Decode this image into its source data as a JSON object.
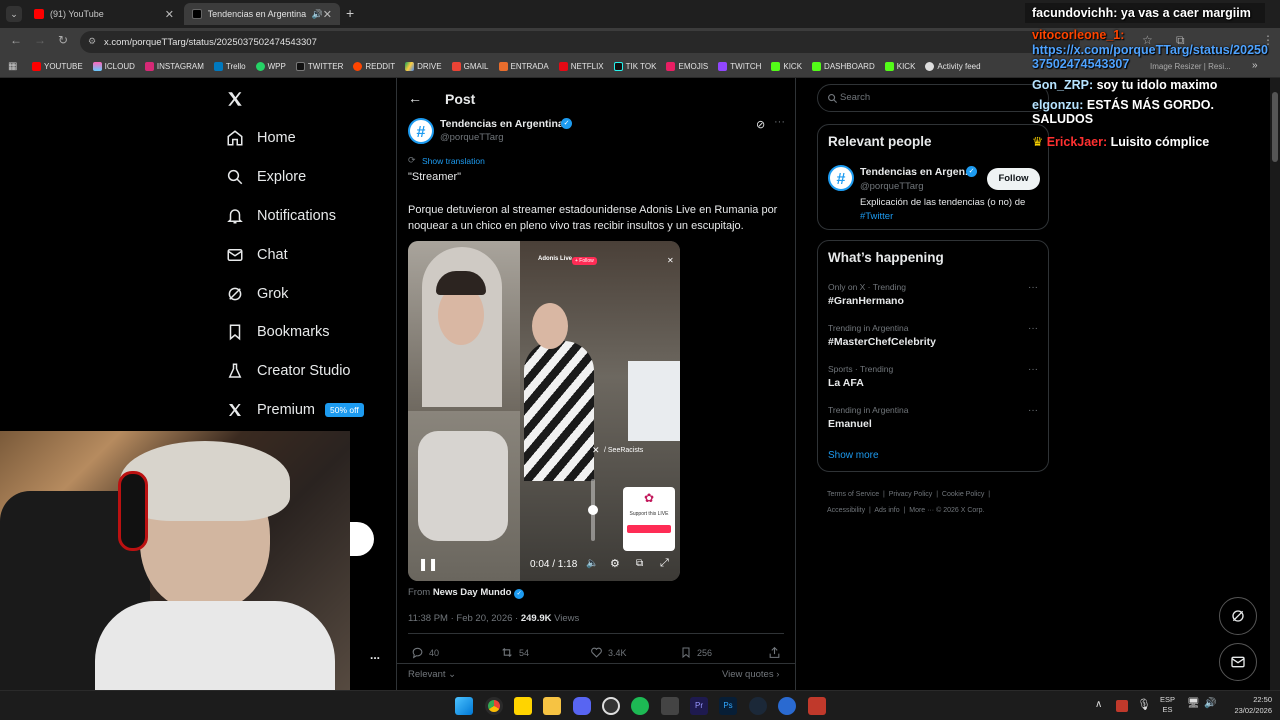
{
  "browser": {
    "tabs": [
      {
        "title": "(91) YouTube",
        "active": false
      },
      {
        "title": "Tendencias en Argentina on",
        "active": true
      }
    ],
    "url": "x.com/porqueTTarg/status/2025037502474543307",
    "bookmarks": [
      "YOUTUBE",
      "ICLOUD",
      "INSTAGRAM",
      "Trello",
      "WPP",
      "TWITTER",
      "REDDIT",
      "DRIVE",
      "GMAIL",
      "ENTRADA",
      "NETFLIX",
      "TIK TOK",
      "EMOJIS",
      "TWITCH",
      "KICK",
      "DASHBOARD",
      "KICK",
      "Activity feed"
    ],
    "bookmark_overflow": "Image Resizer | Resi..."
  },
  "sidebar": {
    "items": [
      {
        "label": "Home",
        "icon": "home-icon"
      },
      {
        "label": "Explore",
        "icon": "search-icon"
      },
      {
        "label": "Notifications",
        "icon": "bell-icon"
      },
      {
        "label": "Chat",
        "icon": "mail-icon"
      },
      {
        "label": "Grok",
        "icon": "grok-icon"
      },
      {
        "label": "Bookmarks",
        "icon": "bookmark-icon"
      },
      {
        "label": "Creator Studio",
        "icon": "flask-icon"
      },
      {
        "label": "Premium",
        "icon": "x-logo-icon"
      }
    ],
    "premium_badge": "50% off",
    "more_dots": "..."
  },
  "post": {
    "header": "Post",
    "author_name": "Tendencias en Argentina",
    "author_handle": "@porqueTTarg",
    "show_translation": "Show translation",
    "title_line": "\"Streamer\"",
    "body": "Porque detuvieron al streamer estadounidense Adonis Live en Rumania por noquear a un chico en pleno vivo tras recibir insultos y un escupitajo.",
    "video_time": "0:04 / 1:18",
    "video_overlay_tag": "/ SeeRacists",
    "video_support": "Support this LIVE",
    "video_streamer": "Adonis Live",
    "video_follow": "+ Follow",
    "from_label": "From",
    "from_source": "News Day Mundo",
    "timestamp": "11:38 PM · Feb 20, 2026 · ",
    "views_count": "249.9K",
    "views_label": " Views",
    "replies": "40",
    "reposts": "54",
    "likes": "3.4K",
    "bookmarks": "256",
    "relevant_label": "Relevant",
    "view_quotes": "View quotes"
  },
  "right": {
    "search_placeholder": "Search",
    "relevant_people_title": "Relevant people",
    "person_name": "Tendencias en Argen...",
    "person_handle": "@porqueTTarg",
    "follow_label": "Follow",
    "person_bio": "Explicación de las tendencias (o no) de",
    "person_bio_tag": "#Twitter",
    "happening_title": "What’s happening",
    "trends": [
      {
        "category": "Only on X · Trending",
        "name": "#GranHermano"
      },
      {
        "category": "Trending in Argentina",
        "name": "#MasterChefCelebrity"
      },
      {
        "category": "Sports · Trending",
        "name": "La AFA"
      },
      {
        "category": "Trending in Argentina",
        "name": "Emanuel"
      }
    ],
    "show_more": "Show more",
    "footer_links": [
      "Terms of Service",
      "Privacy Policy",
      "Cookie Policy",
      "Accessibility",
      "Ads info",
      "More ···",
      "© 2026 X Corp."
    ]
  },
  "chat": [
    {
      "user": "facundovichh:",
      "msg": " ya vas a caer margiim",
      "color": "#ffffff"
    },
    {
      "user": "vitocorleone_1:",
      "msg": "",
      "color": "#ff4500"
    },
    {
      "user": "",
      "msg": "https://x.com/porqueTTarg/status/2025037502474543307",
      "color": "#4fa3ff"
    },
    {
      "user": "Gon_ZRP:",
      "msg": " soy tu idolo maximo",
      "color": "#ffffff"
    },
    {
      "user": "elgonzu:",
      "msg": " ESTÁS MÁS GORDO. SALUDOS",
      "color": "#ffffff"
    },
    {
      "user": "ErickJaer:",
      "msg": " Luisito cómplice",
      "color": "#ff3030"
    }
  ],
  "taskbar": {
    "lang1": "ESP",
    "lang2": "ES",
    "time": "22:50",
    "date": "23/02/2026"
  },
  "colors": {
    "accent": "#1d9bf0",
    "background": "#000000",
    "border": "#2f3336",
    "muted": "#71767b"
  }
}
